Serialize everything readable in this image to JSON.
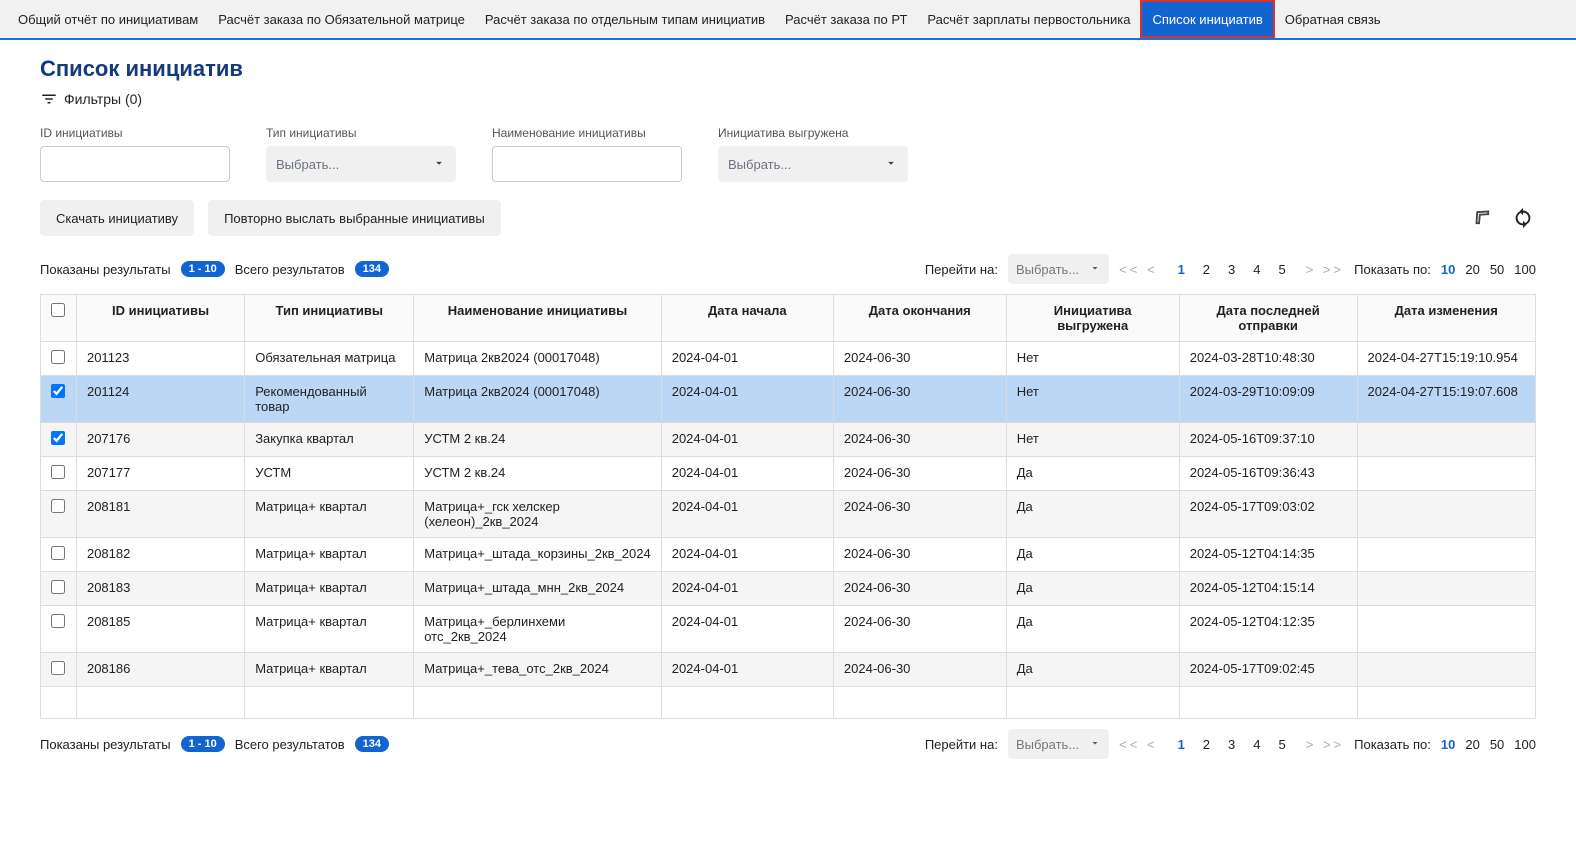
{
  "nav": {
    "items": [
      "Общий отчёт по инициативам",
      "Расчёт заказа по Обязательной матрице",
      "Расчёт заказа по отдельным типам инициатив",
      "Расчёт заказа по РТ",
      "Расчёт зарплаты первостольника",
      "Список инициатив",
      "Обратная связь"
    ],
    "activeIndex": 5
  },
  "page": {
    "title": "Список инициатив",
    "filters_label": "Фильтры (0)"
  },
  "filters": {
    "id_label": "ID инициативы",
    "type_label": "Тип инициативы",
    "type_placeholder": "Выбрать...",
    "name_label": "Наименование инициативы",
    "exported_label": "Инициатива выгружена",
    "exported_placeholder": "Выбрать..."
  },
  "actions": {
    "download": "Скачать инициативу",
    "resend": "Повторно выслать выбранные инициативы"
  },
  "pagination": {
    "shown_label": "Показаны результаты",
    "shown_range": "1 - 10",
    "total_label": "Всего результатов",
    "total_count": "134",
    "goto_label": "Перейти на:",
    "goto_placeholder": "Выбрать...",
    "arrows_left": "<<  <",
    "arrows_right": ">  >>",
    "pages": [
      "1",
      "2",
      "3",
      "4",
      "5"
    ],
    "active_page": "1",
    "show_label": "Показать по:",
    "show_options": [
      "10",
      "20",
      "50",
      "100"
    ],
    "show_active": "10"
  },
  "table": {
    "headers": {
      "id": "ID инициативы",
      "type": "Тип инициативы",
      "name": "Наименование инициативы",
      "start": "Дата начала",
      "end": "Дата окончания",
      "exported": "Инициатива выгружена",
      "last_sent": "Дата последней отправки",
      "modified": "Дата изменения"
    },
    "rows": [
      {
        "checked": false,
        "id": "201123",
        "type": "Обязательная матрица",
        "name": "Матрица 2кв2024 (00017048)",
        "start": "2024-04-01",
        "end": "2024-06-30",
        "exported": "Нет",
        "last_sent": "2024-03-28T10:48:30",
        "modified": "2024-04-27T15:19:10.954",
        "row_class": ""
      },
      {
        "checked": true,
        "id": "201124",
        "type": "Рекомендованный товар",
        "name": "Матрица 2кв2024 (00017048)",
        "start": "2024-04-01",
        "end": "2024-06-30",
        "exported": "Нет",
        "last_sent": "2024-03-29T10:09:09",
        "modified": "2024-04-27T15:19:07.608",
        "row_class": "row-selected"
      },
      {
        "checked": true,
        "id": "207176",
        "type": "Закупка квартал",
        "name": "УСТМ 2 кв.24",
        "start": "2024-04-01",
        "end": "2024-06-30",
        "exported": "Нет",
        "last_sent": "2024-05-16T09:37:10",
        "modified": "",
        "row_class": "row-odd"
      },
      {
        "checked": false,
        "id": "207177",
        "type": "УСТМ",
        "name": "УСТМ 2 кв.24",
        "start": "2024-04-01",
        "end": "2024-06-30",
        "exported": "Да",
        "last_sent": "2024-05-16T09:36:43",
        "modified": "",
        "row_class": ""
      },
      {
        "checked": false,
        "id": "208181",
        "type": "Матрица+ квартал",
        "name": "Матрица+_гск хелскер (хелеон)_2кв_2024",
        "start": "2024-04-01",
        "end": "2024-06-30",
        "exported": "Да",
        "last_sent": "2024-05-17T09:03:02",
        "modified": "",
        "row_class": "row-odd"
      },
      {
        "checked": false,
        "id": "208182",
        "type": "Матрица+ квартал",
        "name": "Матрица+_штада_корзины_2кв_2024",
        "start": "2024-04-01",
        "end": "2024-06-30",
        "exported": "Да",
        "last_sent": "2024-05-12T04:14:35",
        "modified": "",
        "row_class": ""
      },
      {
        "checked": false,
        "id": "208183",
        "type": "Матрица+ квартал",
        "name": "Матрица+_штада_мнн_2кв_2024",
        "start": "2024-04-01",
        "end": "2024-06-30",
        "exported": "Да",
        "last_sent": "2024-05-12T04:15:14",
        "modified": "",
        "row_class": "row-odd"
      },
      {
        "checked": false,
        "id": "208185",
        "type": "Матрица+ квартал",
        "name": "Матрица+_берлинхеми отс_2кв_2024",
        "start": "2024-04-01",
        "end": "2024-06-30",
        "exported": "Да",
        "last_sent": "2024-05-12T04:12:35",
        "modified": "",
        "row_class": ""
      },
      {
        "checked": false,
        "id": "208186",
        "type": "Матрица+ квартал",
        "name": "Матрица+_тева_отс_2кв_2024",
        "start": "2024-04-01",
        "end": "2024-06-30",
        "exported": "Да",
        "last_sent": "2024-05-17T09:02:45",
        "modified": "",
        "row_class": "row-odd"
      }
    ]
  }
}
